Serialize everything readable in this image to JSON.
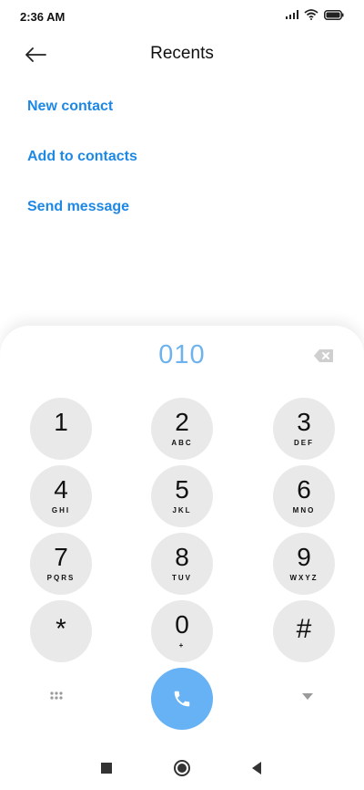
{
  "status_bar": {
    "time": "2:36 AM"
  },
  "header": {
    "title": "Recents"
  },
  "actions": [
    {
      "label": "New contact"
    },
    {
      "label": "Add to contacts"
    },
    {
      "label": "Send message"
    }
  ],
  "dialer": {
    "number": "010",
    "keys": [
      {
        "digit": "1",
        "letters": ""
      },
      {
        "digit": "2",
        "letters": "ABC"
      },
      {
        "digit": "3",
        "letters": "DEF"
      },
      {
        "digit": "4",
        "letters": "GHI"
      },
      {
        "digit": "5",
        "letters": "JKL"
      },
      {
        "digit": "6",
        "letters": "MNO"
      },
      {
        "digit": "7",
        "letters": "PQRS"
      },
      {
        "digit": "8",
        "letters": "TUV"
      },
      {
        "digit": "9",
        "letters": "WXYZ"
      },
      {
        "digit": "*",
        "letters": ""
      },
      {
        "digit": "0",
        "letters": "+"
      },
      {
        "digit": "#",
        "letters": ""
      }
    ]
  },
  "icons": {
    "back": "arrow-left-icon",
    "backspace": "backspace-icon",
    "grid": "dialpad-grid-icon",
    "call": "phone-icon",
    "collapse": "triangle-down-icon"
  },
  "colors": {
    "accent": "#1e88e5",
    "number": "#6fb3ee",
    "call_button": "#67b2f5",
    "key_background": "#e9e9e9"
  }
}
